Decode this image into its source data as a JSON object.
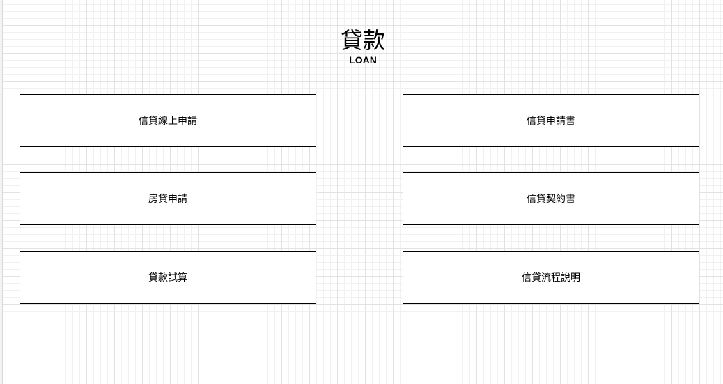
{
  "header": {
    "title": "貸款",
    "subtitle": "LOAN"
  },
  "menu": {
    "items": [
      {
        "label": "信貸線上申請"
      },
      {
        "label": "信貸申請書"
      },
      {
        "label": "房貸申請"
      },
      {
        "label": "信貸契約書"
      },
      {
        "label": "貸款試算"
      },
      {
        "label": "信貸流程說明"
      }
    ]
  },
  "colors": {
    "background": "#ffffff",
    "grid_major": "#e2e2e2",
    "grid_minor": "#f1f1f1",
    "box_border": "#000000",
    "text": "#000000"
  }
}
